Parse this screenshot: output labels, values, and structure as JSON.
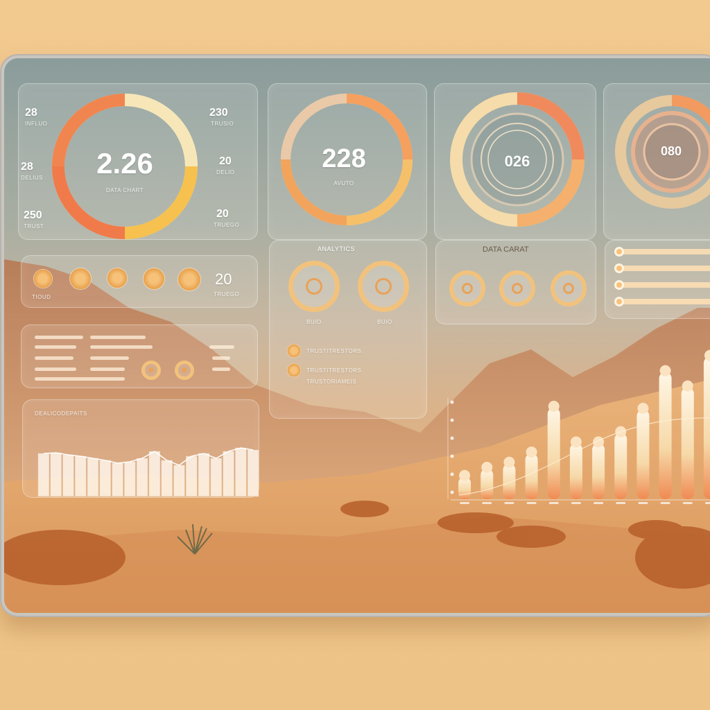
{
  "gauges": [
    {
      "value": "2.26",
      "caption": "DATA CHART"
    },
    {
      "value": "228",
      "caption": "AVUTO"
    },
    {
      "value": "026"
    },
    {
      "value": "080"
    }
  ],
  "gauge1_side_labels": [
    {
      "number": "28",
      "label": "INFLUO"
    },
    {
      "number": "230",
      "label": "TRUSIO"
    },
    {
      "number": "28",
      "label": "DELIUS"
    },
    {
      "number": "20",
      "label": "DELIO"
    },
    {
      "number": "250",
      "label": "TRUST"
    },
    {
      "number": "20",
      "label": "TRUEGO"
    }
  ],
  "panel_row1": {
    "stat": "20",
    "stat_label": "TRUEGO",
    "dot_caption": "TIOUD"
  },
  "panel_analytics": {
    "title": "ANALYTICS",
    "captions": [
      "BUIO",
      "BUIO"
    ],
    "items": [
      "TRUSTITRESTORS",
      "TRUSTITRESTORS",
      "TRUSTORIAMEIS"
    ]
  },
  "panel_data_chart": {
    "title": "DATA CARAT"
  },
  "area_chart_title": "DEALICODEPAITS",
  "colors": {
    "accent": "#f2a154",
    "ring_red": "#f0764e",
    "ring_yellow": "#f6c65a"
  },
  "chart_data": [
    {
      "type": "area",
      "title": "DEALICODEPAITS",
      "values": [
        62,
        63,
        60,
        58,
        55,
        52,
        48,
        50,
        55,
        65,
        52,
        45,
        58,
        62,
        55,
        65,
        70,
        67
      ],
      "ylim": [
        0,
        100
      ]
    },
    {
      "type": "bar",
      "values": [
        22,
        30,
        35,
        45,
        90,
        55,
        55,
        65,
        88,
        125,
        110,
        140
      ],
      "ylim": [
        0,
        150
      ]
    }
  ]
}
